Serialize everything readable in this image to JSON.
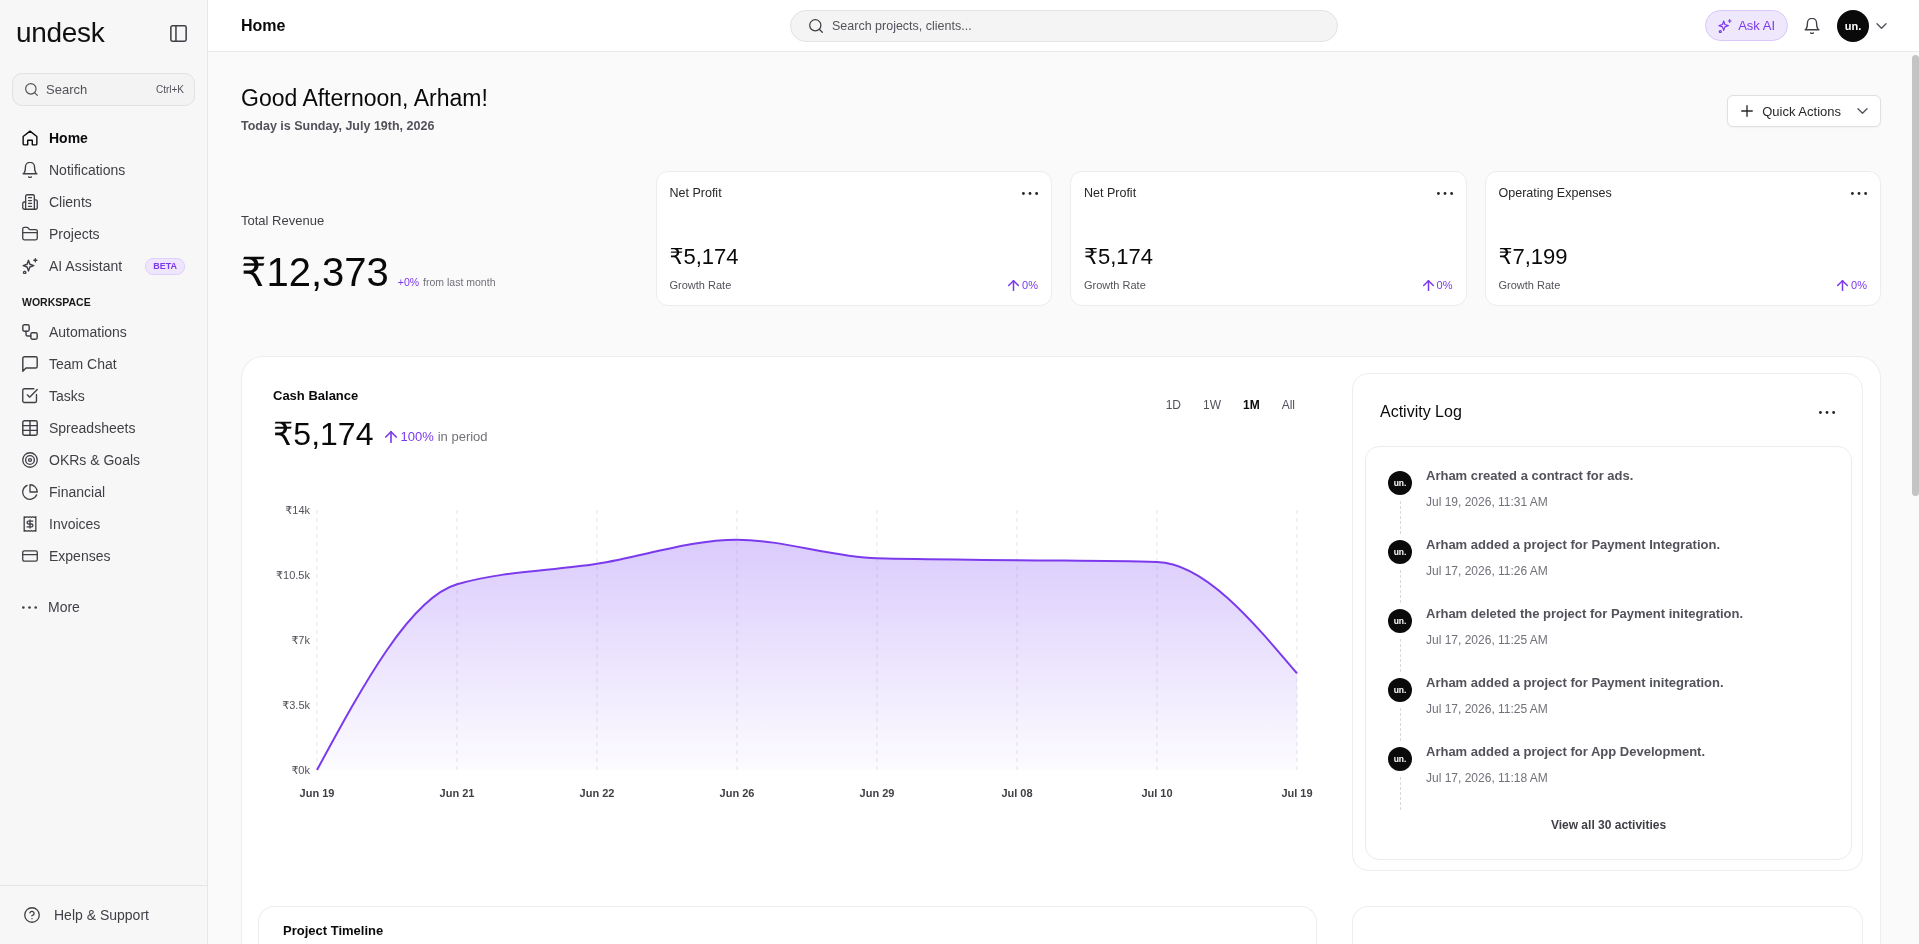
{
  "sidebar": {
    "logo": "undesk",
    "search": {
      "placeholder": "Search",
      "shortcut": "Ctrl+K"
    },
    "items": [
      {
        "label": "Home",
        "selected": true
      },
      {
        "label": "Notifications",
        "selected": false
      },
      {
        "label": "Clients",
        "selected": false
      },
      {
        "label": "Projects",
        "selected": false
      },
      {
        "label": "AI Assistant",
        "selected": false,
        "badge": "BETA"
      }
    ],
    "workspace": {
      "title": "WORKSPACE",
      "items": [
        {
          "label": "Automations",
          "selected": false
        },
        {
          "label": "Team Chat",
          "selected": false
        },
        {
          "label": "Tasks",
          "selected": false
        },
        {
          "label": "Spreadsheets",
          "selected": false
        },
        {
          "label": "OKRs & Goals",
          "selected": false
        },
        {
          "label": "Financial",
          "selected": false
        },
        {
          "label": "Invoices",
          "selected": false
        },
        {
          "label": "Expenses",
          "selected": false
        }
      ]
    },
    "more": "More",
    "help": "Help & Support"
  },
  "header": {
    "title": "Home",
    "search": {
      "placeholder": "Search projects, clients..."
    },
    "ask_ai": "Ask AI",
    "avatar": "un."
  },
  "greeting": {
    "title": "Good Afternoon, Arham!",
    "subtitle": "Today is Sunday, July 19th, 2026",
    "quick_actions": "Quick Actions"
  },
  "total_revenue": {
    "label": "Total Revenue",
    "value": "₹12,373",
    "change": "+0%",
    "note": "from last month"
  },
  "stat_cards": [
    {
      "title": "Net Profit",
      "value": "₹5,174",
      "footer": "Growth Rate",
      "change": "0%"
    },
    {
      "title": "Net Profit",
      "value": "₹5,174",
      "footer": "Growth Rate",
      "change": "0%"
    },
    {
      "title": "Operating Expenses",
      "value": "₹7,199",
      "footer": "Growth Rate",
      "change": "0%"
    }
  ],
  "cash_balance": {
    "value": "₹5,174",
    "change": "100%",
    "note": "in period",
    "ranges": [
      {
        "label": "1D",
        "selected": false
      },
      {
        "label": "1W",
        "selected": false
      },
      {
        "label": "1M",
        "selected": true
      },
      {
        "label": "All",
        "selected": false
      }
    ],
    "chart_data": {
      "type": "area",
      "title": "Cash Balance",
      "categories": [
        "Jun 19",
        "Jun 21",
        "Jun 22",
        "Jun 26",
        "Jun 29",
        "Jul 08",
        "Jul 10",
        "Jul 19"
      ],
      "values": [
        0,
        10000,
        11100,
        12400,
        11400,
        11300,
        11200,
        5200
      ],
      "ylim": [
        0,
        14000
      ],
      "yticks": [
        {
          "value": 0,
          "label": "₹0k"
        },
        {
          "value": 3500,
          "label": "₹3.5k"
        },
        {
          "value": 7000,
          "label": "₹7k"
        },
        {
          "value": 10500,
          "label": "₹10.5k"
        },
        {
          "value": 14000,
          "label": "₹14k"
        }
      ],
      "grid": true
    }
  },
  "activity_log": {
    "title": "Activity Log",
    "items": [
      {
        "avatar": "un.",
        "text": "Arham created a contract for ads.",
        "time": "Jul 19, 2026, 11:31 AM"
      },
      {
        "avatar": "un.",
        "text": "Arham added a project for Payment Integration.",
        "time": "Jul 17, 2026, 11:26 AM"
      },
      {
        "avatar": "un.",
        "text": "Arham deleted the project for Payment initegration.",
        "time": "Jul 17, 2026, 11:25 AM"
      },
      {
        "avatar": "un.",
        "text": "Arham added a project for Payment initegration.",
        "time": "Jul 17, 2026, 11:25 AM"
      },
      {
        "avatar": "un.",
        "text": "Arham added a project for App Development.",
        "time": "Jul 17, 2026, 11:18 AM"
      }
    ],
    "view_all": "View all 30 activities"
  },
  "project_timeline": {
    "title": "Project Timeline"
  }
}
